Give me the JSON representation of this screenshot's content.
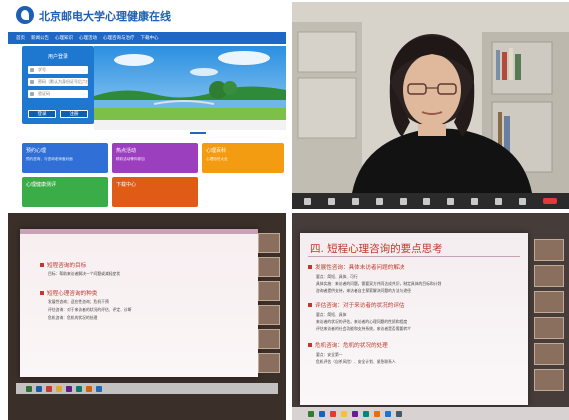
{
  "site": {
    "title": "北京邮电大学心理健康在线",
    "nav": [
      "首页",
      "新闻公告",
      "心理知识",
      "心理活动",
      "心理咨询与治疗",
      "下载中心"
    ],
    "login": {
      "heading": "用户登录",
      "username_value": "学号",
      "password_placeholder": "密码（默认为身份证号后六位）",
      "captcha_placeholder": "验证码",
      "login_label": "登录",
      "register_label": "注册"
    },
    "tiles": [
      {
        "title": "预约心理",
        "sub": "预约咨询，与咨询老师面对面",
        "color": "#2f6fd6"
      },
      {
        "title": "热点活动",
        "sub": "精彩活动等你参加",
        "color": "#9c3fbf"
      },
      {
        "title": "心理百科",
        "sub": "心理知识大全",
        "color": "#f39c12"
      },
      {
        "title": "心理健康测评",
        "sub": "",
        "color": "#3aad49"
      },
      {
        "title": "下载中心",
        "sub": "",
        "color": "#e05c16"
      }
    ]
  },
  "webcam": {
    "bar_color": "#2b2b2b"
  },
  "slide1": {
    "bullets": [
      {
        "text": "短程咨询的目标",
        "sub": "目标：帮助来访者解决一个问题或减轻症状"
      },
      {
        "text": "短程心理咨询的种类",
        "sub": "发展性咨询；适应性咨询；危机干预"
      },
      {
        "text": "",
        "sub": "评估咨询：对于来访者的状况的评估、评定、诊断"
      },
      {
        "text": "",
        "sub": "危机咨询：危机的状况的处理"
      }
    ]
  },
  "slide2": {
    "title": "四. 短程心理咨询的要点思考",
    "bullets": [
      {
        "text": "发展性咨询：具体未访者问题的解决",
        "subs": [
          "要点：简短、具体、可行",
          "具体实施：来访者的问题，需要双方共同达成共识，制定具体的目标和计划",
          "咨询者提供支持，来访者自主探索解决问题的方法与途径"
        ]
      },
      {
        "text": "评估咨询：对于来访者的状况的评估",
        "subs": [
          "要点：简短、具体",
          "来访者的状况的评估，来访者的心理问题的性质和程度",
          "评估来访者的社会功能和支持系统，来访者是否需要转介"
        ]
      },
      {
        "text": "危机咨询：危机的状况的处理",
        "subs": [
          "要点：安全第一",
          "危机评估（自杀风险）、安全计划、紧急联系人"
        ]
      }
    ]
  }
}
